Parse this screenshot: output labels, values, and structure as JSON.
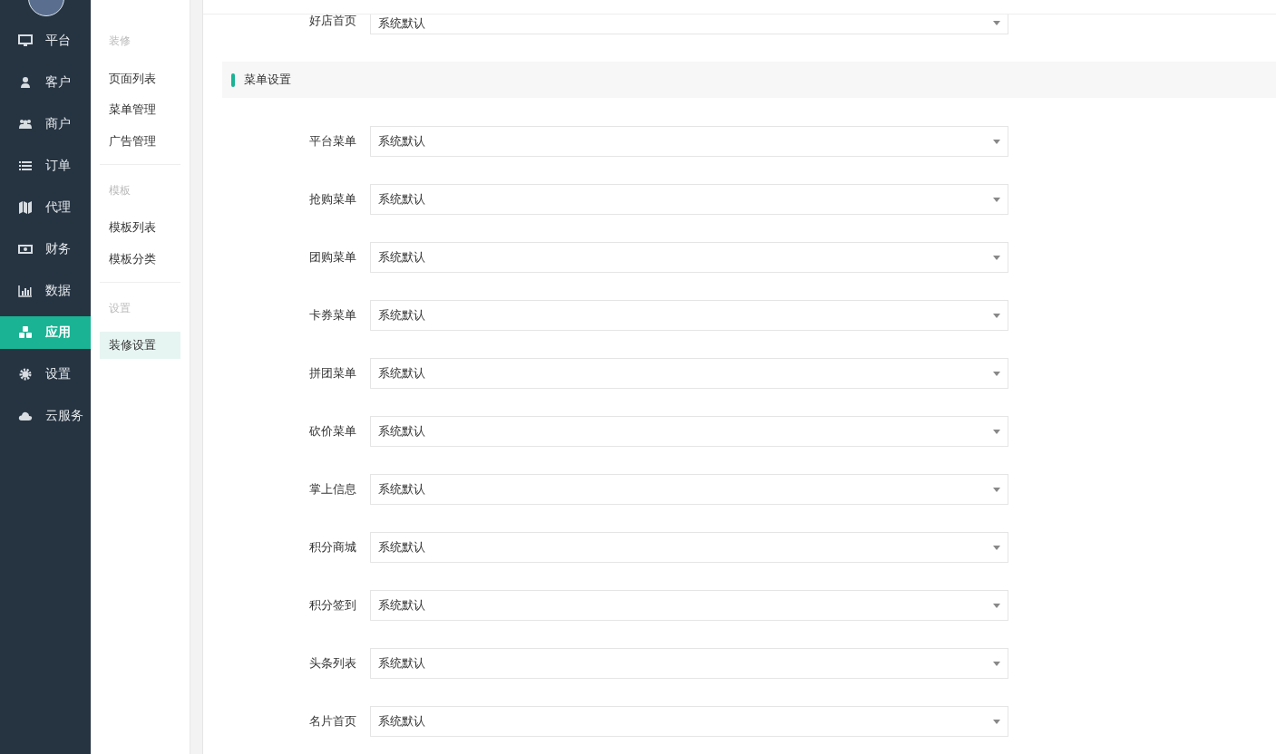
{
  "nav": [
    {
      "kind": "monitor",
      "label": "平台",
      "selected": false
    },
    {
      "kind": "user",
      "label": "客户",
      "selected": false
    },
    {
      "kind": "users",
      "label": "商户",
      "selected": false
    },
    {
      "kind": "list",
      "label": "订单",
      "selected": false
    },
    {
      "kind": "map",
      "label": "代理",
      "selected": false
    },
    {
      "kind": "money",
      "label": "财务",
      "selected": false
    },
    {
      "kind": "chart",
      "label": "数据",
      "selected": false
    },
    {
      "kind": "cubes",
      "label": "应用",
      "selected": true
    },
    {
      "kind": "gear",
      "label": "设置",
      "selected": false
    },
    {
      "kind": "cloud",
      "label": "云服务",
      "selected": false
    }
  ],
  "submenu": [
    {
      "heading": "装修",
      "items": [
        {
          "label": "页面列表",
          "selected": false
        },
        {
          "label": "菜单管理",
          "selected": false
        },
        {
          "label": "广告管理",
          "selected": false
        }
      ]
    },
    {
      "heading": "模板",
      "items": [
        {
          "label": "模板列表",
          "selected": false
        },
        {
          "label": "模板分类",
          "selected": false
        }
      ]
    },
    {
      "heading": "设置",
      "items": [
        {
          "label": "装修设置",
          "selected": true
        }
      ]
    }
  ],
  "top_fields": [
    {
      "label": "好店首页",
      "value": "系统默认"
    }
  ],
  "section": {
    "title": "菜单设置",
    "fields": [
      {
        "label": "平台菜单",
        "value": "系统默认"
      },
      {
        "label": "抢购菜单",
        "value": "系统默认"
      },
      {
        "label": "团购菜单",
        "value": "系统默认"
      },
      {
        "label": "卡券菜单",
        "value": "系统默认"
      },
      {
        "label": "拼团菜单",
        "value": "系统默认"
      },
      {
        "label": "砍价菜单",
        "value": "系统默认"
      },
      {
        "label": "掌上信息",
        "value": "系统默认"
      },
      {
        "label": "积分商城",
        "value": "系统默认"
      },
      {
        "label": "积分签到",
        "value": "系统默认"
      },
      {
        "label": "头条列表",
        "value": "系统默认"
      },
      {
        "label": "名片首页",
        "value": "系统默认"
      }
    ]
  }
}
